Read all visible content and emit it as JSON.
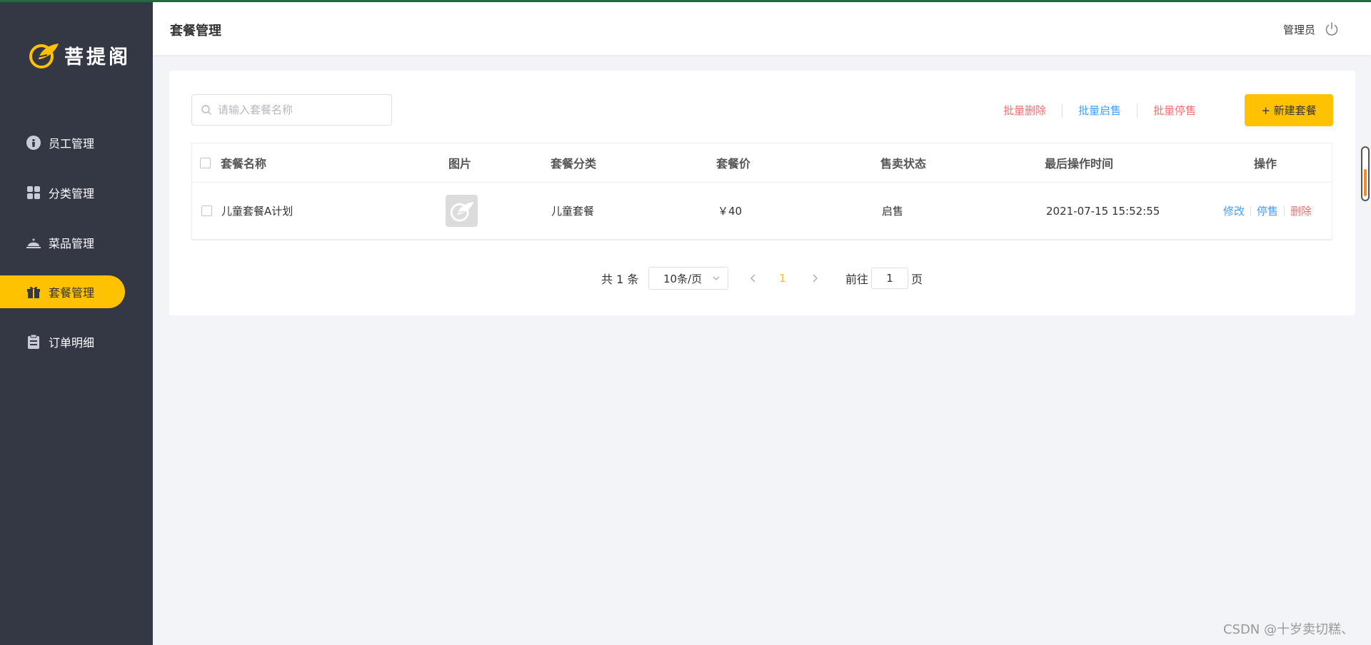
{
  "brand": {
    "name": "菩提阁",
    "accent": "#ffc200",
    "sidebar_bg": "#343744"
  },
  "sidebar": {
    "items": [
      {
        "label": "员工管理",
        "icon": "employee-icon",
        "active": false
      },
      {
        "label": "分类管理",
        "icon": "category-icon",
        "active": false
      },
      {
        "label": "菜品管理",
        "icon": "dish-icon",
        "active": false
      },
      {
        "label": "套餐管理",
        "icon": "gift-icon",
        "active": true
      },
      {
        "label": "订单明细",
        "icon": "clipboard-icon",
        "active": false
      }
    ]
  },
  "header": {
    "title": "套餐管理",
    "user": "管理员",
    "logout_icon": "power-icon"
  },
  "search": {
    "placeholder": "请输入套餐名称",
    "value": ""
  },
  "toolbar": {
    "batch_delete": "批量删除",
    "batch_enable": "批量启售",
    "batch_disable": "批量停售",
    "new_button": "+ 新建套餐"
  },
  "table": {
    "columns": [
      "套餐名称",
      "图片",
      "套餐分类",
      "套餐价",
      "售卖状态",
      "最后操作时间",
      "操作"
    ],
    "rows": [
      {
        "name": "儿童套餐A计划",
        "category": "儿童套餐",
        "price": "￥40",
        "status": "启售",
        "updated": "2021-07-15 15:52:55",
        "actions": {
          "edit": "修改",
          "toggle": "停售",
          "delete": "删除"
        }
      }
    ]
  },
  "pagination": {
    "total": "共 1 条",
    "page_size": "10条/页",
    "current": "1",
    "goto_label": "前往",
    "goto_value": "1",
    "page_suffix": "页"
  },
  "watermark": "CSDN @十岁卖切糕、"
}
